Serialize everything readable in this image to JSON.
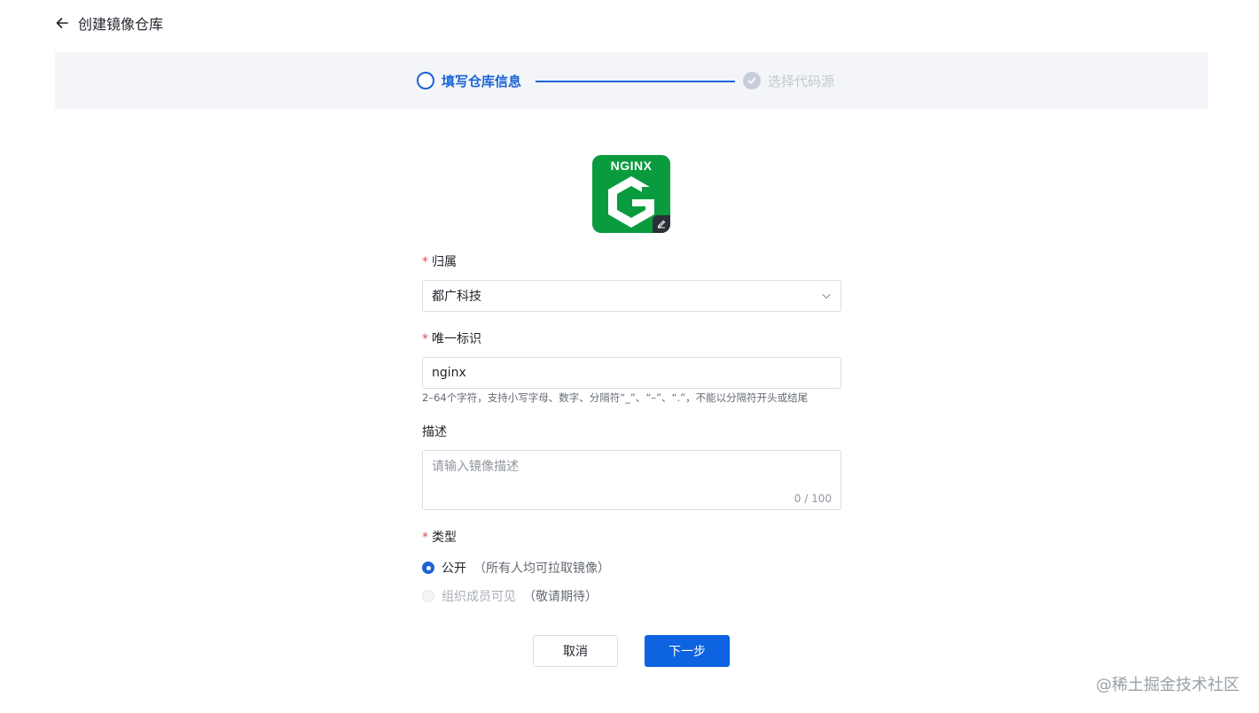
{
  "header": {
    "title": "创建镜像仓库"
  },
  "steps": [
    {
      "label": "填写仓库信息",
      "state": "active"
    },
    {
      "label": "选择代码源",
      "state": "pending"
    }
  ],
  "logo": {
    "text": "NGINX",
    "color": "#0a9b3f"
  },
  "form": {
    "owner": {
      "label": "归属",
      "required_mark": "*",
      "value": "都广科技"
    },
    "identifier": {
      "label": "唯一标识",
      "required_mark": "*",
      "value": "nginx",
      "hint": "2–64个字符，支持小写字母、数字、分隔符“_”、“–”、“.”，不能以分隔符开头或结尾"
    },
    "description": {
      "label": "描述",
      "placeholder": "请输入镜像描述",
      "counter": "0 / 100"
    },
    "type": {
      "label": "类型",
      "required_mark": "*",
      "options": [
        {
          "label": "公开",
          "note": "（所有人均可拉取镜像）",
          "selected": true
        },
        {
          "label": "组织成员可见",
          "note": "（敬请期待）",
          "disabled": true
        }
      ]
    }
  },
  "buttons": {
    "cancel": "取消",
    "next": "下一步"
  },
  "watermark": "@稀土掘金技术社区",
  "colors": {
    "primary": "#1b63d6",
    "button_primary": "#0d63e0",
    "required": "#e5484d"
  }
}
